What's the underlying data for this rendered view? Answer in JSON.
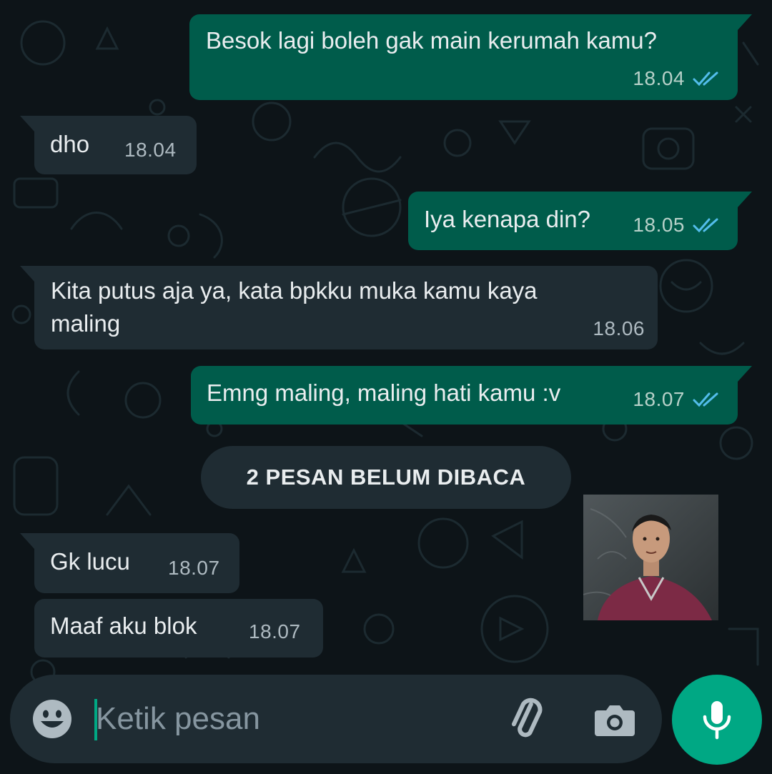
{
  "colors": {
    "background": "#0d1418",
    "outgoing_bubble": "#005c4b",
    "incoming_bubble": "#1f2c33",
    "read_ticks": "#53bdeb",
    "accent": "#00a884"
  },
  "messages": [
    {
      "direction": "outgoing",
      "text": "Besok lagi boleh gak main kerumah kamu?",
      "time": "18.04",
      "status": "read"
    },
    {
      "direction": "incoming",
      "text": "dho",
      "time": "18.04"
    },
    {
      "direction": "outgoing",
      "text": "Iya kenapa din?",
      "time": "18.05",
      "status": "read"
    },
    {
      "direction": "incoming",
      "text_lines": [
        "Kita putus aja ya, kata bpkku muka kamu kaya",
        "maling"
      ],
      "time": "18.06"
    },
    {
      "direction": "outgoing",
      "text": "Emng maling, maling hati kamu :v",
      "time": "18.07",
      "status": "read"
    },
    {
      "direction": "incoming",
      "text": "Gk lucu",
      "time": "18.07"
    },
    {
      "direction": "incoming",
      "text": "Maaf aku blok",
      "time": "18.07"
    }
  ],
  "unread_banner": "2 PESAN BELUM DIBACA",
  "composer": {
    "placeholder": "Ketik pesan",
    "emoji_icon": "emoji-icon",
    "attach_icon": "paperclip-icon",
    "camera_icon": "camera-icon",
    "mic_icon": "microphone-icon"
  }
}
